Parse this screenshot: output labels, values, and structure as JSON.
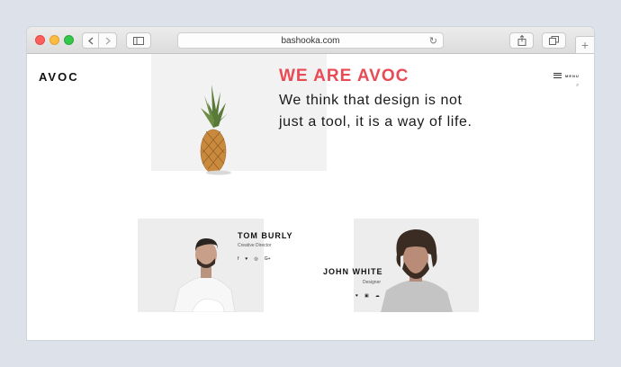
{
  "browser": {
    "url": "bashooka.com",
    "new_tab_label": "+"
  },
  "site": {
    "logo": "AVOC",
    "menu_label": "MENU"
  },
  "hero": {
    "title": "WE ARE AVOC",
    "tagline": "We think that design is not just a tool, it is a way of life."
  },
  "team": [
    {
      "name": "TOM BURLY",
      "role": "Creative Director",
      "socials": [
        "facebook-icon",
        "twitter-icon",
        "dribbble-icon",
        "google-plus-icon"
      ],
      "social_glyphs": [
        "f",
        "♥",
        "◎",
        "G+"
      ]
    },
    {
      "name": "JOHN WHITE",
      "role": "Designer",
      "socials": [
        "twitter-icon",
        "instagram-icon",
        "soundcloud-icon"
      ],
      "social_glyphs": [
        "♥",
        "▣",
        "☁"
      ]
    }
  ],
  "colors": {
    "accent": "#e84b55",
    "page_background": "#dde1ea"
  }
}
